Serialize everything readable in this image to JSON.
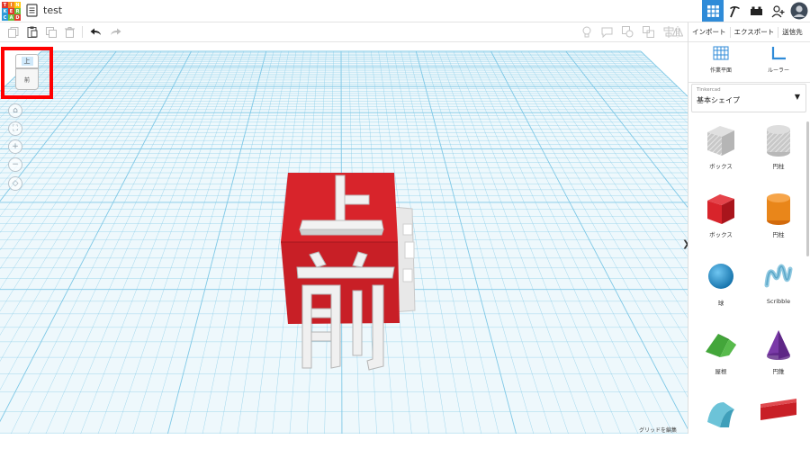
{
  "app": {
    "logo_letters": [
      "T",
      "I",
      "N",
      "K",
      "E",
      "R",
      "C",
      "A",
      "D"
    ],
    "logo_colors": [
      "#e2382d",
      "#f58722",
      "#ffc60b",
      "#2e9bd8",
      "#e2382d",
      "#6bbf3e",
      "#2e9bd8",
      "#6bbf3e",
      "#e2382d"
    ],
    "title": "test"
  },
  "topbar": {
    "icons": [
      "grid-view-icon",
      "build-icon",
      "bricks-icon",
      "add-user-icon",
      "profile-avatar"
    ]
  },
  "toolbar": {
    "left_icons": [
      "copy-icon",
      "paste-icon",
      "duplicate-icon",
      "delete-icon",
      "undo-icon",
      "redo-icon"
    ],
    "right_icons": [
      "note-icon",
      "comment-icon",
      "visibility-icon",
      "group-icon",
      "align-icon",
      "mirror-icon"
    ]
  },
  "panel": {
    "import_label": "インポート",
    "export_label": "エクスポート",
    "send_label": "送信先",
    "workplane_label": "作業平面",
    "ruler_label": "ルーラー",
    "library_source": "Tinkercad",
    "library_name": "基本シェイプ",
    "shapes": [
      {
        "label": "ボックス",
        "kind": "box-hole"
      },
      {
        "label": "円柱",
        "kind": "cylinder-hole"
      },
      {
        "label": "ボックス",
        "kind": "box"
      },
      {
        "label": "円柱",
        "kind": "cylinder"
      },
      {
        "label": "球",
        "kind": "sphere"
      },
      {
        "label": "Scribble",
        "kind": "scribble"
      },
      {
        "label": "屋根",
        "kind": "roof"
      },
      {
        "label": "円錐",
        "kind": "cone"
      },
      {
        "label": "",
        "kind": "round-roof"
      },
      {
        "label": "",
        "kind": "text"
      }
    ]
  },
  "viewcube": {
    "top_label": "上",
    "front_label": "前"
  },
  "model": {
    "top_text": "上",
    "front_text": "前",
    "color": "#d8242b"
  },
  "canvas": {
    "grid_edit_label": "グリッドを編集",
    "collapse_glyph": "❯",
    "grid_color": "#7fc8e6"
  }
}
